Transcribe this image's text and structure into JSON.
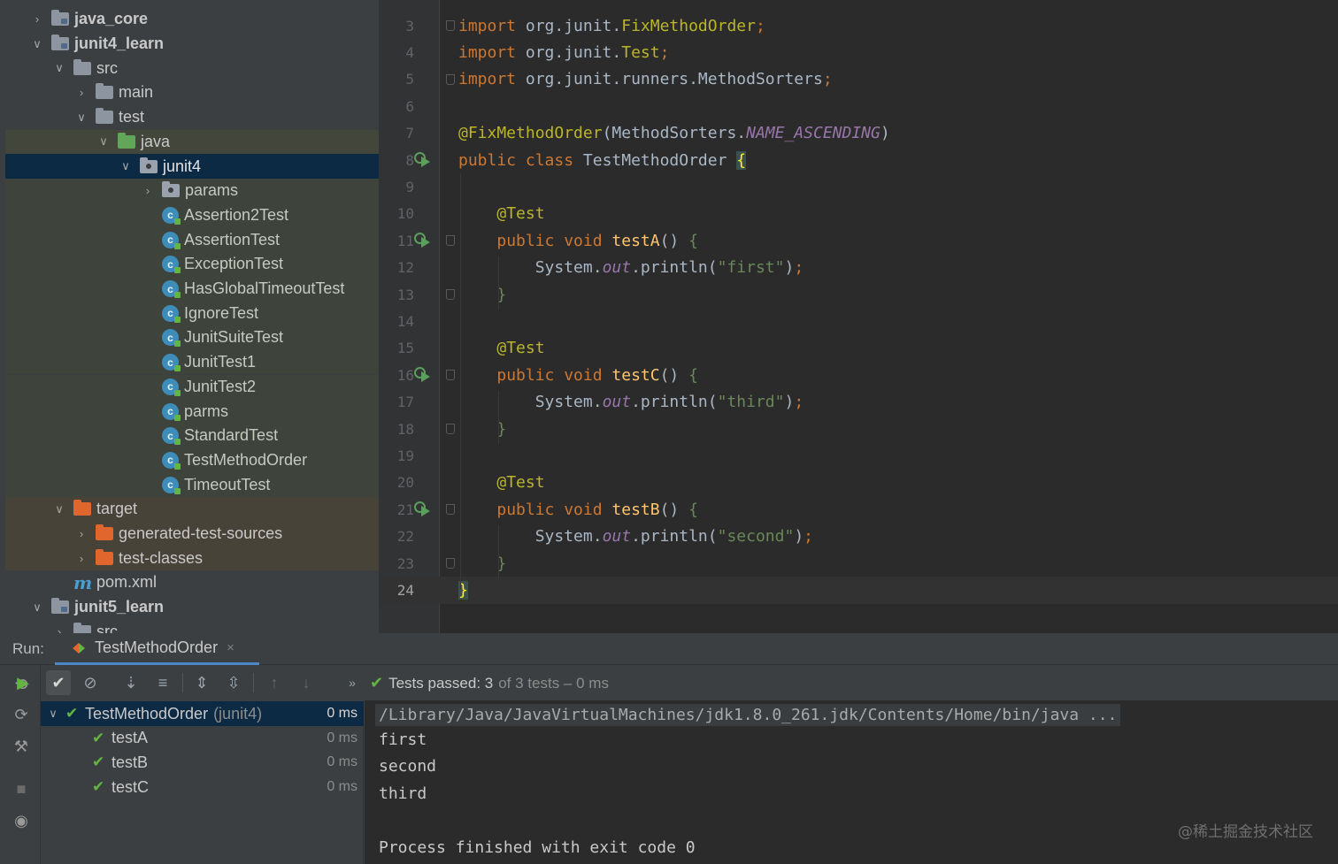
{
  "project_tree": {
    "rows": [
      {
        "label": "java_core",
        "indent": 1,
        "arrow": "right",
        "icon": "module-folder-icon",
        "bold": true
      },
      {
        "label": "junit4_learn",
        "indent": 1,
        "arrow": "down",
        "icon": "module-folder-icon",
        "bold": true
      },
      {
        "label": "src",
        "indent": 2,
        "arrow": "down",
        "icon": "folder-icon"
      },
      {
        "label": "main",
        "indent": 3,
        "arrow": "right",
        "icon": "folder-icon"
      },
      {
        "label": "test",
        "indent": 3,
        "arrow": "down",
        "icon": "folder-icon"
      },
      {
        "label": "java",
        "indent": 4,
        "arrow": "down",
        "icon": "test-source-folder-icon"
      },
      {
        "label": "junit4",
        "indent": 5,
        "arrow": "down",
        "icon": "package-icon",
        "selected": true
      },
      {
        "label": "params",
        "indent": 6,
        "arrow": "right",
        "icon": "package-icon"
      },
      {
        "label": "Assertion2Test",
        "indent": 6,
        "icon": "class-icon"
      },
      {
        "label": "AssertionTest",
        "indent": 6,
        "icon": "class-icon"
      },
      {
        "label": "ExceptionTest",
        "indent": 6,
        "icon": "class-icon"
      },
      {
        "label": "HasGlobalTimeoutTest",
        "indent": 6,
        "icon": "class-icon"
      },
      {
        "label": "IgnoreTest",
        "indent": 6,
        "icon": "class-icon"
      },
      {
        "label": "JunitSuiteTest",
        "indent": 6,
        "icon": "class-icon"
      },
      {
        "label": "JunitTest1",
        "indent": 6,
        "icon": "class-icon"
      },
      {
        "label": "JunitTest2",
        "indent": 6,
        "icon": "class-icon"
      },
      {
        "label": "parms",
        "indent": 6,
        "icon": "class-icon"
      },
      {
        "label": "StandardTest",
        "indent": 6,
        "icon": "class-icon"
      },
      {
        "label": "TestMethodOrder",
        "indent": 6,
        "icon": "class-icon"
      },
      {
        "label": "TimeoutTest",
        "indent": 6,
        "icon": "class-icon"
      },
      {
        "label": "target",
        "indent": 2,
        "arrow": "down",
        "icon": "excluded-folder-icon"
      },
      {
        "label": "generated-test-sources",
        "indent": 3,
        "arrow": "right",
        "icon": "excluded-folder-icon"
      },
      {
        "label": "test-classes",
        "indent": 3,
        "arrow": "right",
        "icon": "excluded-folder-icon"
      },
      {
        "label": "pom.xml",
        "indent": 2,
        "icon": "maven-icon"
      },
      {
        "label": "junit5_learn",
        "indent": 1,
        "arrow": "down",
        "icon": "module-folder-icon",
        "bold": true
      },
      {
        "label": "src",
        "indent": 2,
        "arrow": "right",
        "icon": "folder-icon"
      }
    ]
  },
  "editor": {
    "lines": [
      {
        "n": "3",
        "tokens": [
          [
            "kw",
            "import "
          ],
          [
            "",
            "org.junit."
          ],
          [
            "ann",
            "FixMethodOrder"
          ],
          [
            "pun",
            ";"
          ]
        ],
        "fold": true
      },
      {
        "n": "4",
        "tokens": [
          [
            "kw",
            "import "
          ],
          [
            "",
            "org.junit."
          ],
          [
            "ann",
            "Test"
          ],
          [
            "pun",
            ";"
          ]
        ]
      },
      {
        "n": "5",
        "tokens": [
          [
            "kw",
            "import "
          ],
          [
            "",
            "org.junit.runners.MethodSorters"
          ],
          [
            "pun",
            ";"
          ]
        ],
        "fold": true
      },
      {
        "n": "6",
        "tokens": []
      },
      {
        "n": "7",
        "tokens": [
          [
            "ann",
            "@FixMethodOrder"
          ],
          [
            "",
            "(MethodSorters."
          ],
          [
            "fld",
            "NAME_ASCENDING"
          ],
          [
            "",
            ")"
          ]
        ]
      },
      {
        "n": "8",
        "tokens": [
          [
            "kw",
            "public class "
          ],
          [
            "",
            "TestMethodOrder "
          ],
          [
            "brace-hl",
            "{"
          ]
        ],
        "run": true
      },
      {
        "n": "9",
        "tokens": []
      },
      {
        "n": "10",
        "tokens": [
          [
            "",
            "    "
          ],
          [
            "ann",
            "@Test"
          ]
        ]
      },
      {
        "n": "11",
        "tokens": [
          [
            "",
            "    "
          ],
          [
            "kw",
            "public void "
          ],
          [
            "fn",
            "testA"
          ],
          [
            "",
            "() "
          ],
          [
            "brace-g",
            "{"
          ]
        ],
        "run": true,
        "fold": true
      },
      {
        "n": "12",
        "tokens": [
          [
            "",
            "        System."
          ],
          [
            "fld",
            "out"
          ],
          [
            "",
            ".println("
          ],
          [
            "str",
            "\"first\""
          ],
          [
            "",
            ")"
          ],
          [
            "pun",
            ";"
          ]
        ]
      },
      {
        "n": "13",
        "tokens": [
          [
            "",
            "    "
          ],
          [
            "brace-g",
            "}"
          ]
        ],
        "fold": true
      },
      {
        "n": "14",
        "tokens": []
      },
      {
        "n": "15",
        "tokens": [
          [
            "",
            "    "
          ],
          [
            "ann",
            "@Test"
          ]
        ]
      },
      {
        "n": "16",
        "tokens": [
          [
            "",
            "    "
          ],
          [
            "kw",
            "public void "
          ],
          [
            "fn",
            "testC"
          ],
          [
            "",
            "() "
          ],
          [
            "brace-g",
            "{"
          ]
        ],
        "run": true,
        "fold": true
      },
      {
        "n": "17",
        "tokens": [
          [
            "",
            "        System."
          ],
          [
            "fld",
            "out"
          ],
          [
            "",
            ".println("
          ],
          [
            "str",
            "\"third\""
          ],
          [
            "",
            ")"
          ],
          [
            "pun",
            ";"
          ]
        ]
      },
      {
        "n": "18",
        "tokens": [
          [
            "",
            "    "
          ],
          [
            "brace-g",
            "}"
          ]
        ],
        "fold": true
      },
      {
        "n": "19",
        "tokens": []
      },
      {
        "n": "20",
        "tokens": [
          [
            "",
            "    "
          ],
          [
            "ann",
            "@Test"
          ]
        ]
      },
      {
        "n": "21",
        "tokens": [
          [
            "",
            "    "
          ],
          [
            "kw",
            "public void "
          ],
          [
            "fn",
            "testB"
          ],
          [
            "",
            "() "
          ],
          [
            "brace-g",
            "{"
          ]
        ],
        "run": true,
        "fold": true
      },
      {
        "n": "22",
        "tokens": [
          [
            "",
            "        System."
          ],
          [
            "fld",
            "out"
          ],
          [
            "",
            ".println("
          ],
          [
            "str",
            "\"second\""
          ],
          [
            "",
            ")"
          ],
          [
            "pun",
            ";"
          ]
        ]
      },
      {
        "n": "23",
        "tokens": [
          [
            "",
            "    "
          ],
          [
            "brace-g",
            "}"
          ]
        ],
        "fold": true
      },
      {
        "n": "24",
        "tokens": [
          [
            "brace-hl",
            "}"
          ]
        ],
        "current": true
      }
    ]
  },
  "run_panel": {
    "label": "Run:",
    "tab_title": "TestMethodOrder",
    "tab_close": "×",
    "summary": {
      "passed_text": "Tests passed: 3",
      "rest_text": "of 3 tests – 0 ms"
    },
    "toolbar_icons": [
      "rerun-icon",
      "show-passed-icon",
      "show-ignored-icon",
      "sort-alpha-icon",
      "sort-duration-icon",
      "expand-all-icon",
      "collapse-all-icon",
      "prev-failed-icon",
      "next-failed-icon",
      "more-icon"
    ],
    "tests": [
      {
        "name": "TestMethodOrder",
        "pkg": "(junit4)",
        "time": "0 ms",
        "root": true
      },
      {
        "name": "testA",
        "time": "0 ms"
      },
      {
        "name": "testB",
        "time": "0 ms"
      },
      {
        "name": "testC",
        "time": "0 ms"
      }
    ],
    "console": {
      "command": "/Library/Java/JavaVirtualMachines/jdk1.8.0_261.jdk/Contents/Home/bin/java ...",
      "output": [
        "first",
        "second",
        "third",
        "",
        "Process finished with exit code 0"
      ]
    },
    "watermark": "@稀土掘金技术社区"
  },
  "colors": {
    "keyword": "#cc7832",
    "annotation": "#bbb529",
    "string": "#6a8759",
    "method": "#ffc66d",
    "success": "#62b543",
    "selection": "#0d2a45"
  }
}
